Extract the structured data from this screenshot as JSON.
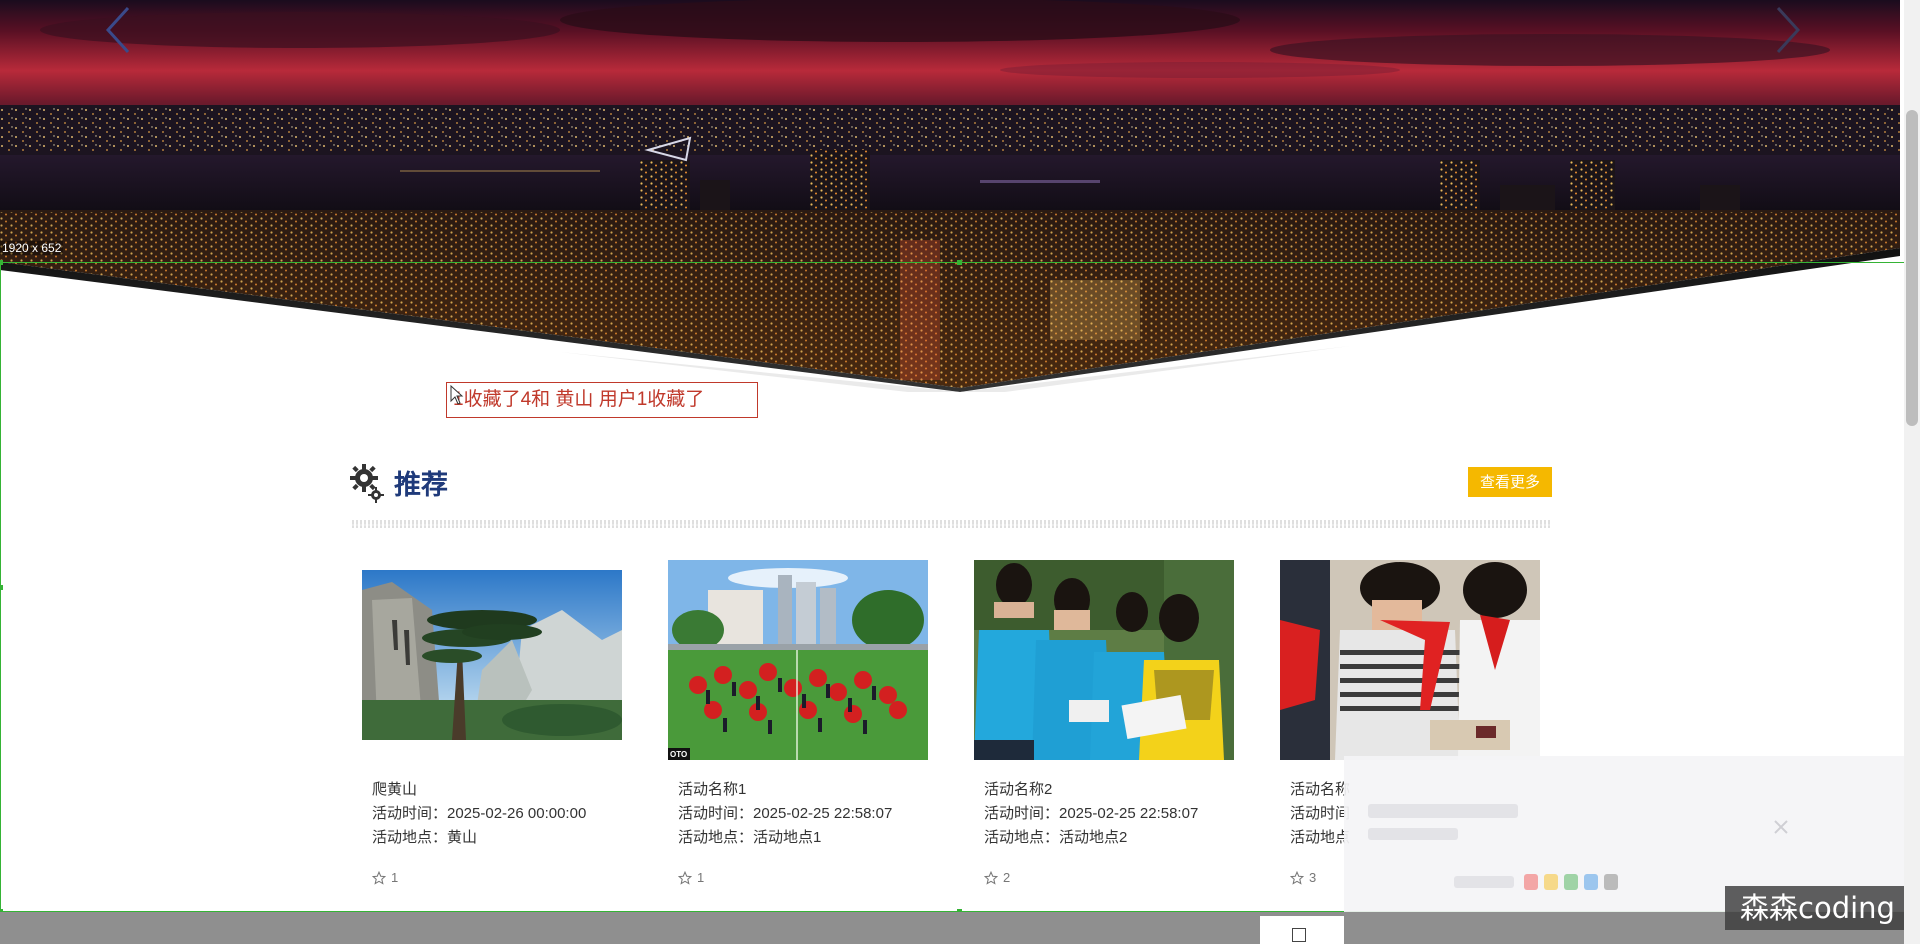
{
  "hero": {
    "size_label": "1920 x 652"
  },
  "notice": {
    "text": "1收藏了4和 黄山   用户1收藏了"
  },
  "section": {
    "title": "推荐",
    "more_label": "查看更多"
  },
  "cards": [
    {
      "name": "爬黄山",
      "time": "活动时间：2025-02-26 00:00:00",
      "place": "活动地点：黄山",
      "favorites": "1"
    },
    {
      "name": "活动名称1",
      "time": "活动时间：2025-02-25 22:58:07",
      "place": "活动地点：活动地点1",
      "favorites": "1",
      "photo_tag": "OTO"
    },
    {
      "name": "活动名称2",
      "time": "活动时间：2025-02-25 22:58:07",
      "place": "活动地点：活动地点2",
      "favorites": "2"
    },
    {
      "name": "活动名称",
      "time": "活动时间",
      "place": "活动地点",
      "favorites": "3"
    }
  ],
  "watermark": "森森coding",
  "colors": {
    "accent": "#f5b800",
    "title": "#1f3a7a",
    "notice": "#c0392b",
    "selection": "#35b335"
  }
}
